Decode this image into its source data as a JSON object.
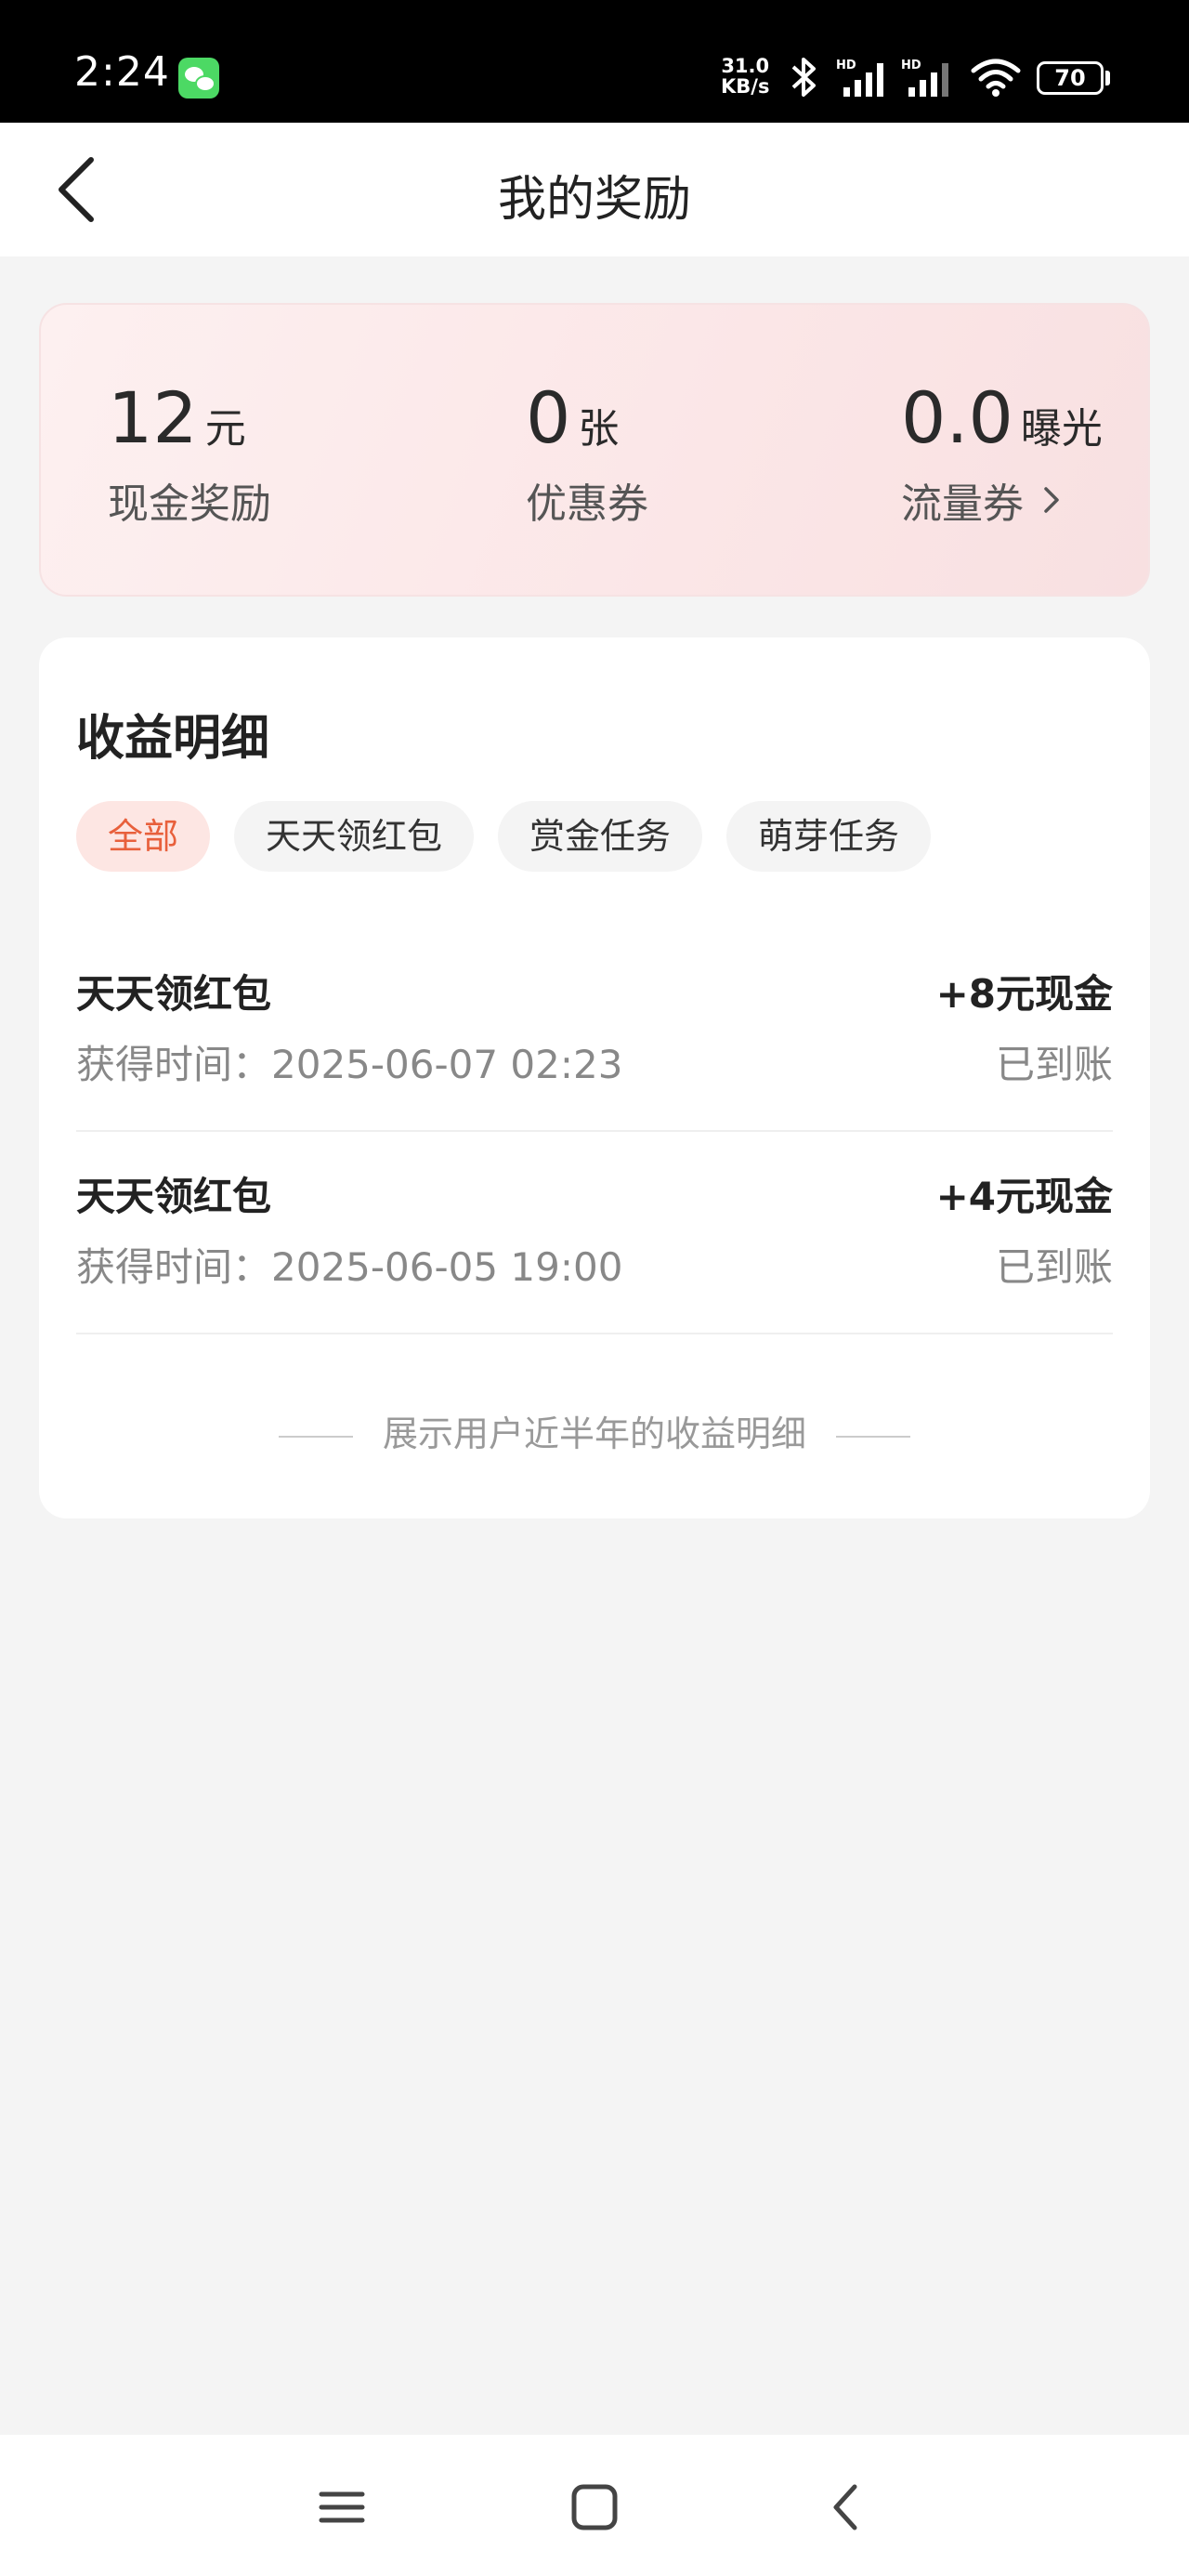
{
  "status_bar": {
    "time": "2:24",
    "net_speed_value": "31.0",
    "net_speed_unit": "KB/s",
    "battery": "70",
    "icons": [
      "wechat-icon",
      "bluetooth-icon",
      "signal-icon",
      "signal-icon",
      "wifi-icon",
      "battery-icon"
    ]
  },
  "header": {
    "title": "我的奖励"
  },
  "rewards": {
    "cash": {
      "value": "12",
      "unit": "元",
      "label": "现金奖励"
    },
    "coupon": {
      "value": "0",
      "unit": "张",
      "label": "优惠券"
    },
    "traffic": {
      "value": "0.0",
      "unit": "曝光",
      "label": "流量券"
    }
  },
  "details": {
    "title": "收益明细",
    "filters": [
      "全部",
      "天天领红包",
      "赏金任务",
      "萌芽任务"
    ],
    "active_filter": "全部",
    "records": [
      {
        "name": "天天领红包",
        "time": "获得时间：2025-06-07 02:23",
        "amount": "+8元现金",
        "status": "已到账"
      },
      {
        "name": "天天领红包",
        "time": "获得时间：2025-06-05 19:00",
        "amount": "+4元现金",
        "status": "已到账"
      }
    ],
    "footer": "展示用户近半年的收益明细"
  },
  "colors": {
    "accent": "#e8603c",
    "card_pink": "#fbe6e7",
    "background": "#f4f4f4"
  }
}
